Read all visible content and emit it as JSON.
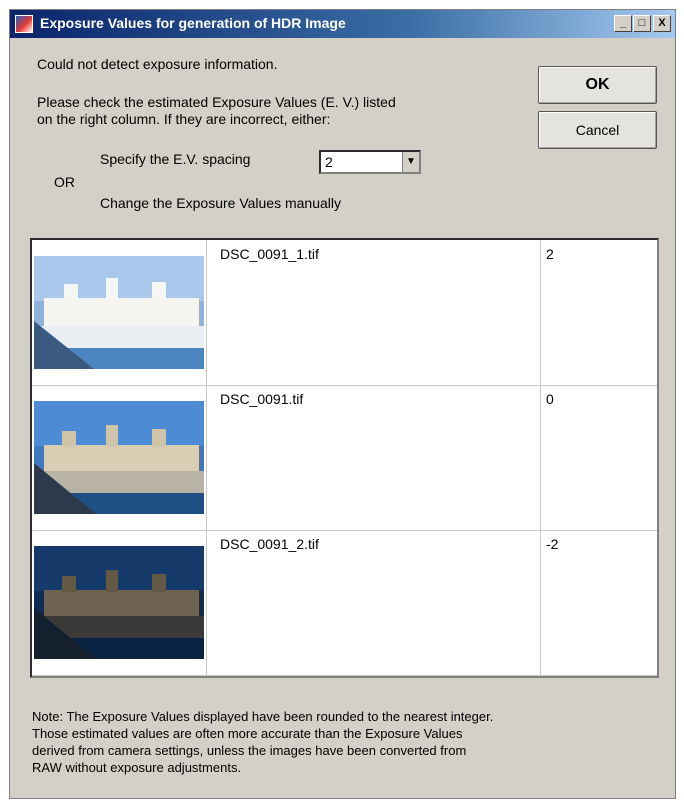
{
  "window": {
    "title": "Exposure Values for generation of HDR Image"
  },
  "controls": {
    "minimize": "_",
    "maximize": "□",
    "close": "X"
  },
  "message": {
    "line1": "Could not detect exposure information.",
    "line2": "Please check the estimated Exposure Values (E. V.) listed",
    "line3": "on the right column. If they are incorrect, either:"
  },
  "spacing": {
    "label": "Specify the E.V.  spacing",
    "value": "2"
  },
  "or_label": "OR",
  "manual_label": "Change the Exposure Values manually",
  "buttons": {
    "ok": "OK",
    "cancel": "Cancel"
  },
  "images": [
    {
      "file": "DSC_0091_1.tif",
      "ev": "2"
    },
    {
      "file": "DSC_0091.tif",
      "ev": "0"
    },
    {
      "file": "DSC_0091_2.tif",
      "ev": "-2"
    }
  ],
  "note": {
    "line1": "Note: The Exposure Values displayed have been rounded to the nearest integer.",
    "line2": "Those estimated values are often more accurate than the Exposure Values",
    "line3": "derived from camera settings, unless the images have been converted from",
    "line4": "RAW without exposure adjustments."
  }
}
